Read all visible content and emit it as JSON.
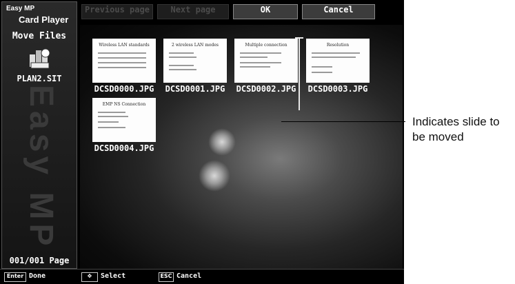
{
  "brand": {
    "line1": "Easy MP",
    "line2": "Card Player"
  },
  "sidebar": {
    "title": "Move Files",
    "file_name": "PLAN2.SIT",
    "watermark": "Easy MP",
    "page_count": "001/001 Page",
    "icon": "archive-file-icon"
  },
  "toolbar": {
    "previous": "Previous page",
    "next": "Next page",
    "ok": "OK",
    "cancel": "Cancel"
  },
  "slides": [
    {
      "filename": "DCSD0000.JPG",
      "title": "Wireless LAN standards"
    },
    {
      "filename": "DCSD0001.JPG",
      "title": "2 wireless LAN modes"
    },
    {
      "filename": "DCSD0002.JPG",
      "title": "Multiple connection"
    },
    {
      "filename": "DCSD0003.JPG",
      "title": "Resolution"
    },
    {
      "filename": "DCSD0004.JPG",
      "title": "EMP NS Connection"
    }
  ],
  "statusbar": {
    "enter_key": "Enter",
    "enter_label": "Done",
    "arrow_label": "Select",
    "esc_key": "ESC",
    "esc_label": "Cancel"
  },
  "callout": {
    "text": "Indicates slide to be moved"
  }
}
